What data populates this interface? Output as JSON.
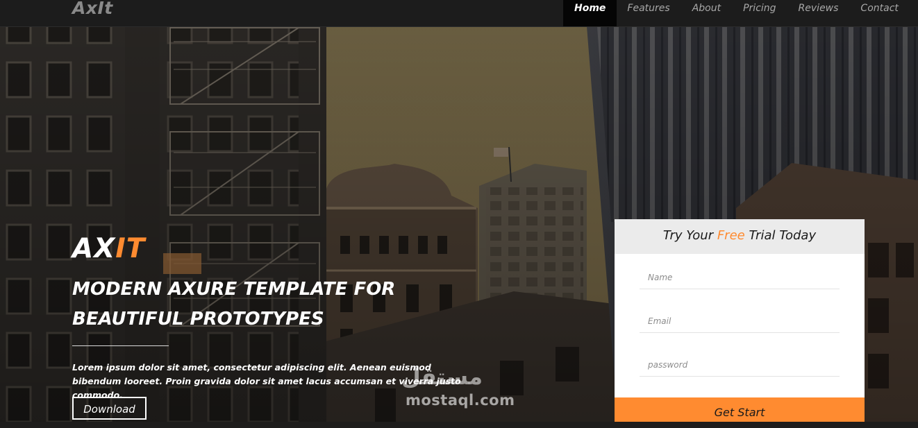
{
  "brand": {
    "name": "AxIt"
  },
  "nav": {
    "items": [
      {
        "label": "Home",
        "active": true
      },
      {
        "label": "Features",
        "active": false
      },
      {
        "label": "About",
        "active": false
      },
      {
        "label": "Pricing",
        "active": false
      },
      {
        "label": "Reviews",
        "active": false
      },
      {
        "label": "Contact",
        "active": false
      }
    ]
  },
  "hero": {
    "logo_part1": "AX",
    "logo_part2": "IT",
    "title": "MODERN AXURE TEMPLATE FOR BEAUTIFUL PROTOTYPES",
    "text": "Lorem ipsum dolor sit amet, consectetur adipiscing elit. Aenean euismod bibendum looreet. Proin gravida dolor sit amet lacus accumsan et viverra justo commodo.",
    "download_label": "Download"
  },
  "trial_form": {
    "title_before": "Try Your ",
    "title_highlight": "Free",
    "title_after": " Trial Today",
    "name_placeholder": "Name",
    "email_placeholder": "Email",
    "password_placeholder": "password",
    "submit_label": "Get Start"
  },
  "watermark": {
    "logo": "مستقل",
    "text": "mostaql.com"
  },
  "colors": {
    "accent": "#ff8b30",
    "navbar": "#1c1c1c",
    "nav_active": "#050505",
    "form_header": "#ebebeb"
  }
}
